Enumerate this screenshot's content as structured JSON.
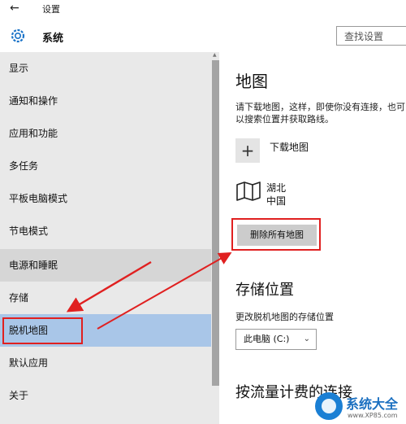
{
  "window": {
    "title": "设置"
  },
  "header": {
    "title": "系统",
    "search_placeholder": "查找设置"
  },
  "sidebar": {
    "items": [
      {
        "label": "显示"
      },
      {
        "label": "通知和操作"
      },
      {
        "label": "应用和功能"
      },
      {
        "label": "多任务"
      },
      {
        "label": "平板电脑模式"
      },
      {
        "label": "节电模式"
      },
      {
        "label": "电源和睡眠"
      },
      {
        "label": "存储"
      },
      {
        "label": "脱机地图"
      },
      {
        "label": "默认应用"
      },
      {
        "label": "关于"
      }
    ],
    "hovered_item": "电源和睡眠",
    "selected_item": "脱机地图"
  },
  "content": {
    "maps": {
      "heading": "地图",
      "description": "请下载地图，这样，即使你没有连接，也可以搜索位置并获取路线。",
      "download_label": "下载地图",
      "region": {
        "name": "湖北",
        "country": "中国"
      },
      "delete_all_button": "删除所有地图"
    },
    "storage": {
      "heading": "存储位置",
      "label": "更改脱机地图的存储位置",
      "selected_value": "此电脑 (C:)"
    },
    "metered": {
      "heading": "按流量计费的连接"
    }
  },
  "colors": {
    "annotation": "#e02020",
    "selected": "#a9c6e8",
    "sidebar_bg": "#e9e9e9"
  },
  "watermark": {
    "name": "系统大全",
    "url": "www.XP85.com"
  }
}
